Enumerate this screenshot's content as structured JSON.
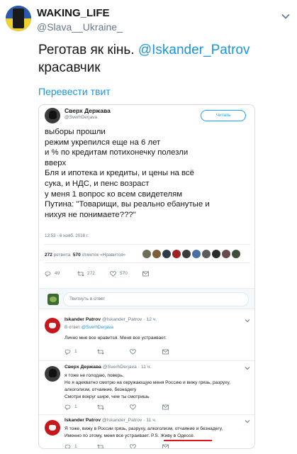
{
  "outer": {
    "name": "WAKING_LIFE",
    "handle": "@Slava__Ukraine_",
    "text_before": "Реготав як кінь. ",
    "mention": "@Iskander_Patrov",
    "text_after": " красавчик",
    "translate": "Перевести твит"
  },
  "quoted": {
    "name": "Сверх Держава",
    "handle": "@SverhDerjava",
    "follow": "Читать",
    "lines": [
      "выборы прошли",
      "режим укрепился еще на 6 лет",
      "и % по кредитам потихонечку полезли",
      "вверх",
      "Бля и ипотека и кредиты, и цены на всё",
      "сука, и НДС, и пенс возраст",
      "у меня 1 вопрос ко всем свидетелям",
      "Путина: \"Товарищи, вы реально ебанутые и",
      "нихуя не понимаете???\""
    ],
    "time": "13:53 - 6 нояб. 2018 г.",
    "retweets_num": "272",
    "retweets_label": "ретвита",
    "likes_num": "570",
    "likes_label": "отметок «Нравится»",
    "actions": {
      "replies": "49",
      "retweets": "272",
      "likes": "570"
    },
    "reply_placeholder": "Твитнуть в ответ"
  },
  "replies": [
    {
      "name": "Iskander Patrov",
      "handle": "@Iskander_Patrov · 12 ч.",
      "sub_prefix": "В ответ ",
      "sub_mention": "@SverhDerjava",
      "lines": [
        "Лично мне все нравится. Меня все устраивает."
      ],
      "actions": {
        "replies": "1",
        "retweets": "",
        "likes": ""
      }
    },
    {
      "name": "Сверх Держава",
      "handle": "@SverhDerjava · 11 ч.",
      "lines": [
        "я тоже не голодаю, поверь.",
        "Но я адекватно смотрю на окружающую меня Россию и вижу грязь, разруху,",
        "алкоголизм, отчаяние, безнадегу",
        "Смотри вокруг шире, чем ты смотришь"
      ],
      "actions": {
        "replies": "1",
        "retweets": "",
        "likes": ""
      }
    },
    {
      "name": "Iskander Patrov",
      "handle": "@Iskander_Patrov · 11 ч.",
      "lines": [
        "Я тоже, вижу в России грязь, разруху, алкоголизм, отчаяние и безнадегу.",
        "Именно по этому, меня все устраивает. P.S. Живу в Одессе."
      ],
      "actions": {
        "replies": "1",
        "retweets": "",
        "likes": ""
      }
    }
  ],
  "colors": {
    "accent": "#1b95e0",
    "follow": "#1da1f2",
    "underline": "#e0141c"
  }
}
